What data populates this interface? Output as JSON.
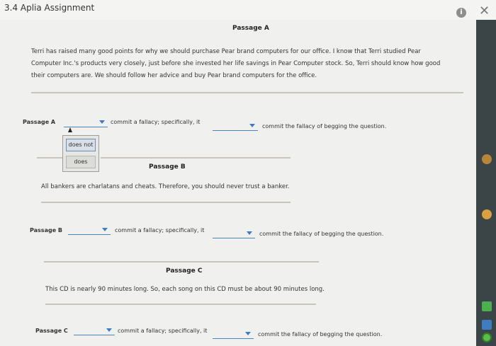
{
  "window": {
    "title": "3.4 Aplia Assignment"
  },
  "passageA": {
    "heading": "Passage A",
    "lines": [
      "Terri has raised many good points for why we should purchase Pear brand computers for our office. I know that Terri studied Pear",
      "Computer Inc.'s products very closely, just before she invested her life savings in Pear Computer stock. So, Terri should know how good",
      "their computers are. We should follow her advice and buy Pear brand computers for the office."
    ]
  },
  "rowA": {
    "label": "Passage A",
    "mid_text": "commit a fallacy; specifically, it",
    "end_text": "commit the fallacy of begging the question.",
    "menu_options": [
      "does not",
      "does"
    ]
  },
  "passageB": {
    "heading": "Passage B",
    "text": "All bankers are charlatans and cheats. Therefore, you should never trust a banker."
  },
  "rowB": {
    "label": "Passage B",
    "mid_text": "commit a fallacy; specifically, it",
    "end_text": "commit the fallacy of begging the question."
  },
  "passageC": {
    "heading": "Passage C",
    "text": "This CD is nearly 90 minutes long. So, each song on this CD must be about 90 minutes long."
  },
  "rowC": {
    "label": "Passage C",
    "mid_text": "commit a fallacy; specifically, it",
    "end_text": "commit the fallacy of begging the question."
  },
  "colors": {
    "accent": "#3f7cc0",
    "sidebar": "#3b4447"
  },
  "icons": [
    "info-icon",
    "close-icon",
    "chrome-icon",
    "tag-icon",
    "drive-icon",
    "docs-icon",
    "circle-app-icon"
  ]
}
